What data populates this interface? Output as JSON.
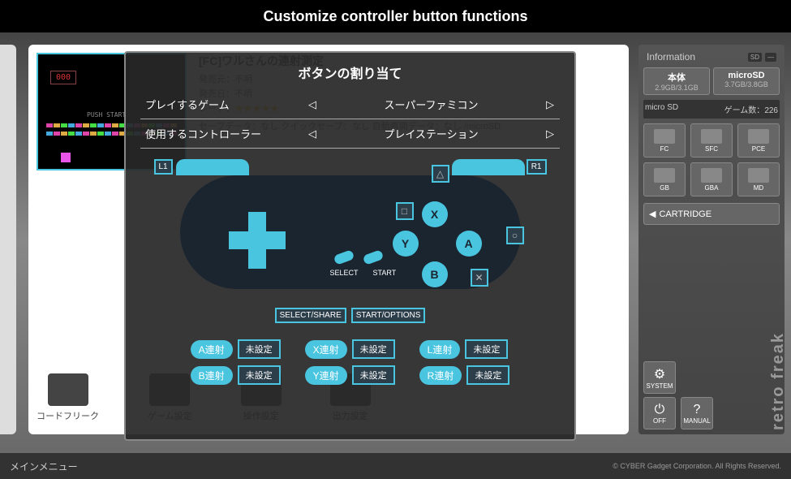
{
  "banner": {
    "title": "Customize controller button functions"
  },
  "bg": {
    "title": "[FC]ワルさんの連射測定",
    "publisher_label": "発売元：",
    "publisher": "不明",
    "release_label": "発売日：",
    "release": "不明",
    "rate_label": "レート：",
    "save_info": "セーブデータ：なし  クイックセーブ：なし  自動再開データ：なし /microSD",
    "preview_score": "000",
    "preview_start": "PUSH  START",
    "icons": [
      {
        "label": "コードフリーク"
      },
      {
        "label": "ゲーム設定"
      },
      {
        "label": "操作設定"
      },
      {
        "label": "出力設定"
      }
    ]
  },
  "dialog": {
    "title": "ボタンの割り当て",
    "rows": [
      {
        "label": "プレイするゲーム",
        "value": "スーパーファミコン"
      },
      {
        "label": "使用するコントローラー",
        "value": "プレイステーション"
      }
    ],
    "shoulder": {
      "l1": "L1",
      "r1": "R1"
    },
    "face": {
      "x": "X",
      "y": "Y",
      "a": "A",
      "b": "B"
    },
    "ps": {
      "tri": "△",
      "sq": "□",
      "cir": "○",
      "cross": "✕"
    },
    "center": {
      "select_label": "SELECT",
      "start_label": "START",
      "select_map": "SELECT/SHARE",
      "start_map": "START/OPTIONS"
    },
    "turbo": {
      "unset": "未設定",
      "col1": [
        {
          "btn": "A連射"
        },
        {
          "btn": "B連射"
        }
      ],
      "col2": [
        {
          "btn": "X連射"
        },
        {
          "btn": "Y連射"
        }
      ],
      "col3": [
        {
          "btn": "L連射"
        },
        {
          "btn": "R連射"
        }
      ]
    }
  },
  "sidebar": {
    "info_title": "Information",
    "storage": [
      {
        "label": "本体",
        "val": "2.9GB/3.1GB"
      },
      {
        "label": "microSD",
        "val": "3.7GB/3.8GB"
      }
    ],
    "sd_label": "micro SD",
    "game_count_label": "ゲーム数：",
    "game_count": "226",
    "consoles": [
      "FC",
      "SFC",
      "PCE",
      "GB",
      "GBA",
      "MD"
    ],
    "cartridge": "CARTRIDGE",
    "system": [
      {
        "icon": "⚙",
        "label": "SYSTEM"
      },
      {
        "icon": "⏻",
        "label": "OFF"
      },
      {
        "icon": "?",
        "label": "MANUAL"
      }
    ],
    "logo": "retro freak"
  },
  "footer": {
    "menu": "メインメニュー",
    "copyright": "© CYBER Gadget Corporation. All Rights Reserved."
  },
  "colors": {
    "accent": "#49c5e0"
  }
}
